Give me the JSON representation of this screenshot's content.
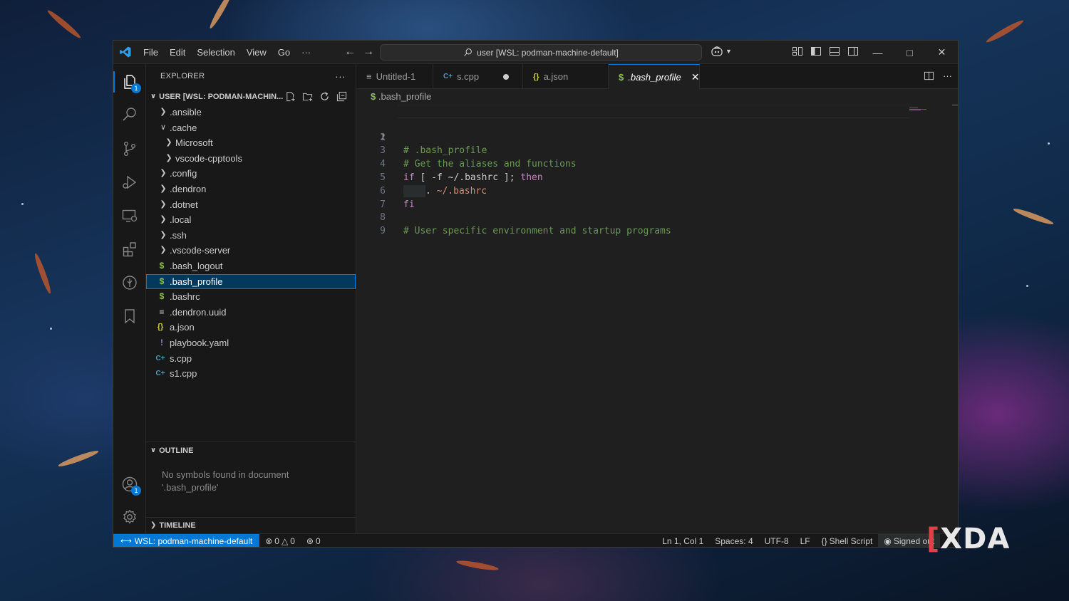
{
  "titlebar": {
    "menu": [
      "File",
      "Edit",
      "Selection",
      "View",
      "Go",
      "···"
    ],
    "search_text": "user [WSL: podman-machine-default]"
  },
  "activity": {
    "explorer_badge": "1",
    "accounts_badge": "1"
  },
  "sidebar": {
    "header": "EXPLORER",
    "root_title": "USER [WSL: PODMAN-MACHIN...",
    "items": [
      {
        "label": ".ansible",
        "icon": "chevron-right"
      },
      {
        "label": ".cache",
        "icon": "chevron-down"
      },
      {
        "label": "Microsoft",
        "icon": "chevron-right"
      },
      {
        "label": "vscode-cpptools",
        "icon": "chevron-right"
      },
      {
        "label": ".config",
        "icon": "chevron-right"
      },
      {
        "label": ".dendron",
        "icon": "chevron-right"
      },
      {
        "label": ".dotnet",
        "icon": "chevron-right"
      },
      {
        "label": ".local",
        "icon": "chevron-right"
      },
      {
        "label": ".ssh",
        "icon": "chevron-right"
      },
      {
        "label": ".vscode-server",
        "icon": "chevron-right"
      },
      {
        "label": ".bash_logout",
        "icon": "shell-file-icon",
        "glyph": "$"
      },
      {
        "label": ".bash_profile",
        "icon": "shell-file-icon",
        "glyph": "$"
      },
      {
        "label": ".bashrc",
        "icon": "shell-file-icon",
        "glyph": "$"
      },
      {
        "label": ".dendron.uuid",
        "icon": "text-file-icon",
        "glyph": "≡"
      },
      {
        "label": "a.json",
        "icon": "json-file-icon",
        "glyph": "{}"
      },
      {
        "label": "playbook.yaml",
        "icon": "yaml-file-icon",
        "glyph": "!"
      },
      {
        "label": "s.cpp",
        "icon": "cpp-file-icon",
        "glyph": "C+"
      },
      {
        "label": "s1.cpp",
        "icon": "cpp-file-icon",
        "glyph": "C+"
      }
    ],
    "outline_title": "OUTLINE",
    "outline_empty_1": "No symbols found in document",
    "outline_empty_2": "'.bash_profile'",
    "timeline_title": "TIMELINE"
  },
  "tabs": [
    {
      "label": "Untitled-1",
      "icon": "text-file-icon"
    },
    {
      "label": "s.cpp",
      "icon": "cpp-file-icon",
      "modified": true
    },
    {
      "label": "a.json",
      "icon": "json-file-icon"
    },
    {
      "label": ".bash_profile",
      "icon": "shell-file-icon",
      "active": true
    }
  ],
  "breadcrumb": ".bash_profile",
  "editor": {
    "lines": [
      "1",
      "2",
      "3",
      "4",
      "5",
      "6",
      "7",
      "8",
      "9"
    ],
    "code": {
      "l1": "# .bash_profile",
      "l3": "# Get the aliases and functions",
      "l4_if": "if",
      "l4_mid": " [ -f ~/.bashrc ]; ",
      "l4_then": "then",
      "l5_dot": ". ",
      "l5_path": "~/.bashrc",
      "l6": "fi",
      "l8": "# User specific environment and startup programs"
    }
  },
  "status": {
    "remote": "WSL: podman-machine-default",
    "errors": "0",
    "warnings": "0",
    "ports": "0",
    "position": "Ln 1, Col 1",
    "spaces": "Spaces: 4",
    "encoding": "UTF-8",
    "eol": "LF",
    "language": "Shell Script",
    "account": "Signed out"
  },
  "watermark": "XDA",
  "colors": {
    "accent": "#0078d4",
    "comment": "#6a9955",
    "keyword": "#c586c0",
    "string": "#ce9178",
    "shell_icon": "#8dc149",
    "json_icon": "#cbcb41",
    "cpp_icon": "#519aba",
    "yaml_icon": "#a074c4"
  }
}
